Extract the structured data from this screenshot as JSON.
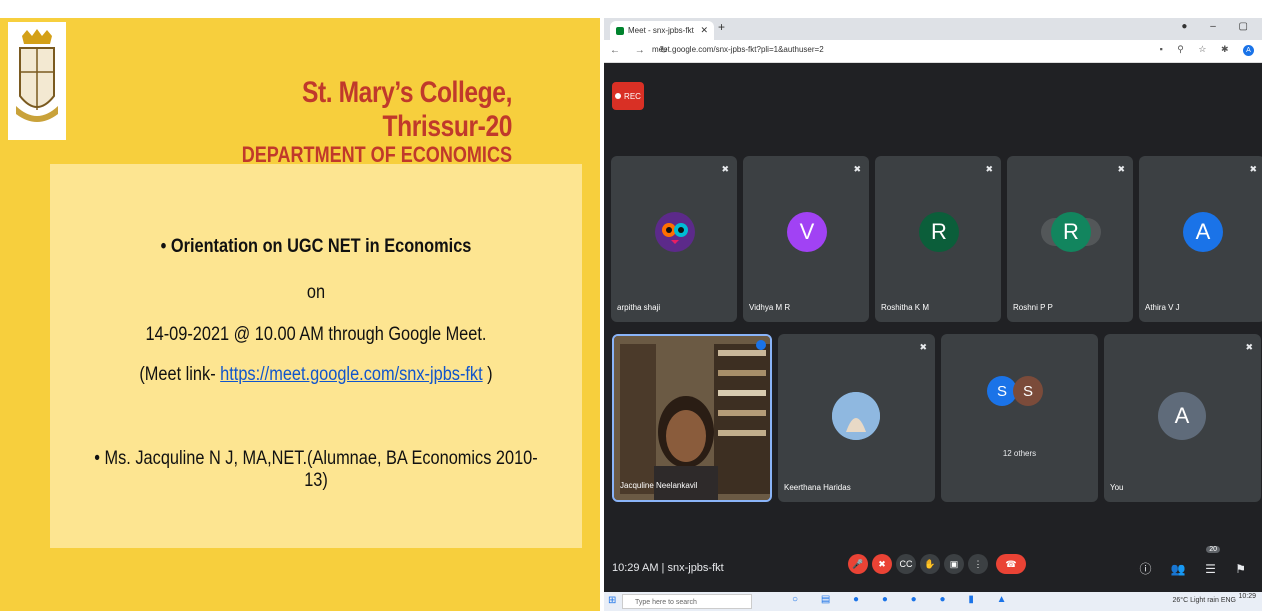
{
  "slide": {
    "logo_alt": "college-crest",
    "title": "St. Mary’s College, Thrissur-20",
    "subtitle": "DEPARTMENT OF ECONOMICS",
    "line1": "• Orientation on UGC  NET in Economics",
    "line2": "on",
    "line3": "14-09-2021 @ 10.00 AM through Google Meet.",
    "line4_prefix": "(Meet link- ",
    "line4_link": "https://meet.google.com/snx-jpbs-fkt",
    "line4_suffix": " )",
    "line5": "• Ms. Jacquline N J, MA,NET.(Alumnae, BA Economics 2010-13)"
  },
  "browser": {
    "tab_title": "Meet - snx-jpbs-fkt",
    "url": "meet.google.com/snx-jpbs-fkt?pli=1&authuser=2",
    "profile_initial": "A"
  },
  "meet": {
    "rec_label": "REC",
    "participants_row1": [
      {
        "name": "arpitha shaji",
        "initial": "",
        "color": "#5c2a8a"
      },
      {
        "name": "Vidhya M R",
        "initial": "V",
        "color": "#a142f4"
      },
      {
        "name": "Roshitha K M",
        "initial": "R",
        "color": "#0b5e3a"
      },
      {
        "name": "Roshni P P",
        "initial": "R",
        "color": "#12855e"
      },
      {
        "name": "Athira V J",
        "initial": "A",
        "color": "#1a73e8"
      }
    ],
    "participants_row2": [
      {
        "name": "Jacquline Neelankavil",
        "initial": "",
        "color": "#5a4632"
      },
      {
        "name": "Keerthana Haridas",
        "initial": "",
        "color": "#6fa8dc"
      },
      {
        "name": "12 others",
        "initial": "",
        "color": "#3c4043"
      },
      {
        "name": "You",
        "initial": "A",
        "color": "#5f6b7a"
      }
    ],
    "others_initials": [
      "S",
      "S"
    ],
    "time": "10:29 AM",
    "meeting_code": "snx-jpbs-fkt",
    "participant_count": "20"
  },
  "taskbar": {
    "search_placeholder": "Type here to search",
    "weather": "26°C  Light rain",
    "lang": "ENG",
    "clock": "10:29"
  }
}
